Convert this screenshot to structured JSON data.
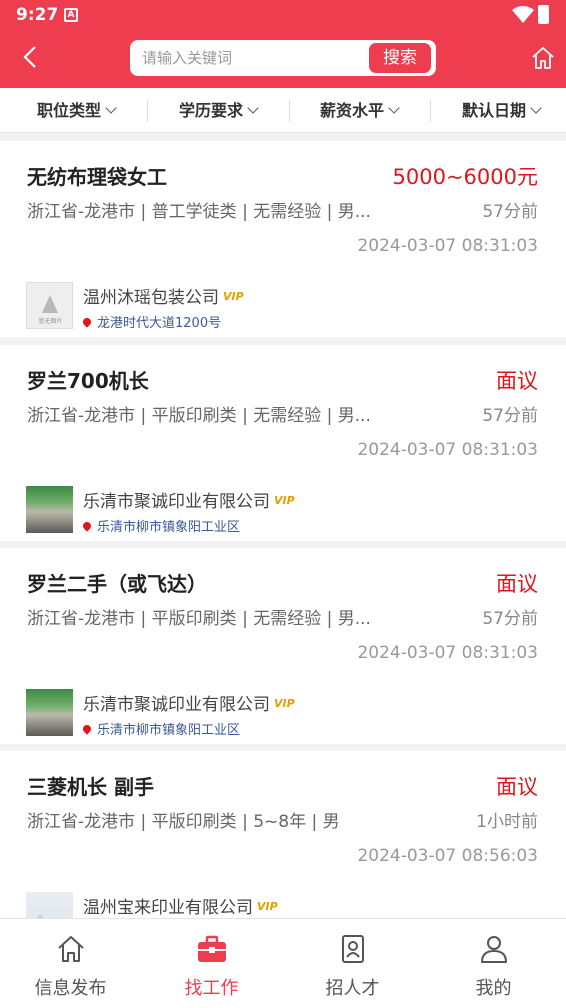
{
  "status": {
    "time": "9:27",
    "notif_icon": "A"
  },
  "search": {
    "placeholder": "请输入关键词",
    "button": "搜索"
  },
  "filters": [
    "职位类型",
    "学历要求",
    "薪资水平",
    "默认日期"
  ],
  "jobs": [
    {
      "title": "无纺布理袋女工",
      "salary": "5000~6000元",
      "meta": "浙江省-龙港市 | 普工学徒类 | 无需经验 | 男...",
      "ago": "57分前",
      "date": "2024-03-07 08:31:03",
      "company": "温州沐瑶包装公司",
      "vip": "VIP",
      "address": "龙港时代大道1200号",
      "logo_text": "暂无图片"
    },
    {
      "title": "罗兰700机长",
      "salary": "面议",
      "meta": "浙江省-龙港市 | 平版印刷类 | 无需经验 | 男...",
      "ago": "57分前",
      "date": "2024-03-07 08:31:03",
      "company": "乐清市聚诚印业有限公司",
      "vip": "VIP",
      "address": "乐清市柳市镇象阳工业区"
    },
    {
      "title": "罗兰二手（或飞达）",
      "salary": "面议",
      "meta": "浙江省-龙港市 | 平版印刷类 | 无需经验 | 男...",
      "ago": "57分前",
      "date": "2024-03-07 08:31:03",
      "company": "乐清市聚诚印业有限公司",
      "vip": "VIP",
      "address": "乐清市柳市镇象阳工业区"
    },
    {
      "title": "三菱机长 副手",
      "salary": "面议",
      "meta": "浙江省-龙港市 | 平版印刷类 | 5~8年 | 男",
      "ago": "1小时前",
      "date": "2024-03-07 08:56:03",
      "company": "温州宝来印业有限公司",
      "vip": "VIP",
      "address": ""
    }
  ],
  "tabs": [
    {
      "label": "信息发布",
      "icon": "home-icon",
      "active": false
    },
    {
      "label": "找工作",
      "icon": "briefcase-icon",
      "active": true
    },
    {
      "label": "招人才",
      "icon": "resume-icon",
      "active": false
    },
    {
      "label": "我的",
      "icon": "user-icon",
      "active": false
    }
  ],
  "colors": {
    "brand": "#ee3d4f",
    "salary": "#e0161b",
    "vip": "#e0a000",
    "address": "#3b5998"
  }
}
